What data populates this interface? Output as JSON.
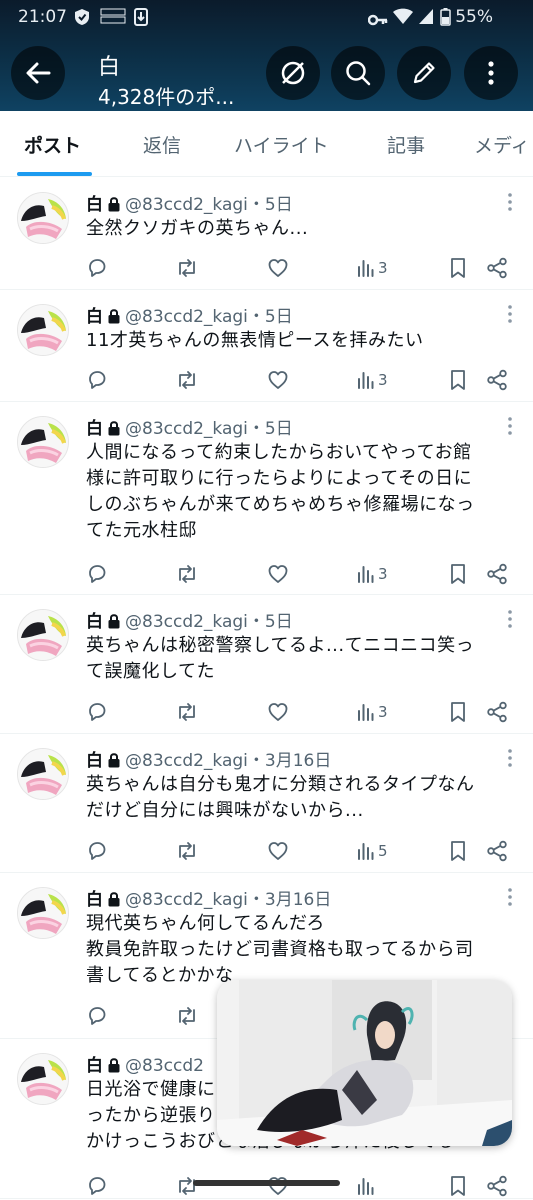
{
  "status_bar": {
    "time": "21:07",
    "battery": "55%"
  },
  "header": {
    "title": "白",
    "subtitle": "4,328件のポ..."
  },
  "tabs": [
    {
      "label": "ポスト"
    },
    {
      "label": "返信"
    },
    {
      "label": "ハイライト"
    },
    {
      "label": "記事"
    },
    {
      "label": "メディ"
    }
  ],
  "posts": [
    {
      "name": "白",
      "handle": "@83ccd2_kagi",
      "date": "・5日",
      "text": "全然クソガキの英ちゃん...",
      "views": "3"
    },
    {
      "name": "白",
      "handle": "@83ccd2_kagi",
      "date": "・5日",
      "text": "11才英ちゃんの無表情ピースを拝みたい",
      "views": "3"
    },
    {
      "name": "白",
      "handle": "@83ccd2_kagi",
      "date": "・5日",
      "text": "人間になるって約束したからおいてやってお館\n様に許可取りに行ったらよりによってその日に\nしのぶちゃんが来てめちゃめちゃ修羅場になっ\nてた元水柱邸",
      "views": "3"
    },
    {
      "name": "白",
      "handle": "@83ccd2_kagi",
      "date": "・5日",
      "text": "英ちゃんは秘密警察してるよ...てニコニコ笑っ\nて誤魔化してた",
      "views": "3"
    },
    {
      "name": "白",
      "handle": "@83ccd2_kagi",
      "date": "・3月16日",
      "text": "英ちゃんは自分も鬼才に分類されるタイプなん\nだけど自分には興味がないから...",
      "views": "5"
    },
    {
      "name": "白",
      "handle": "@83ccd2_kagi",
      "date": "・3月16日",
      "text": "現代英ちゃん何してるんだろ\n教員免許取ったけど司書資格も取ってるから司\n書してるとかかな",
      "views": ""
    },
    {
      "name": "白",
      "handle": "@83ccd2",
      "date": "",
      "text": "日光浴で健康に\nったから逆張り\nかけっこうおびとな治びなから汁た稜してる",
      "views": ""
    }
  ]
}
